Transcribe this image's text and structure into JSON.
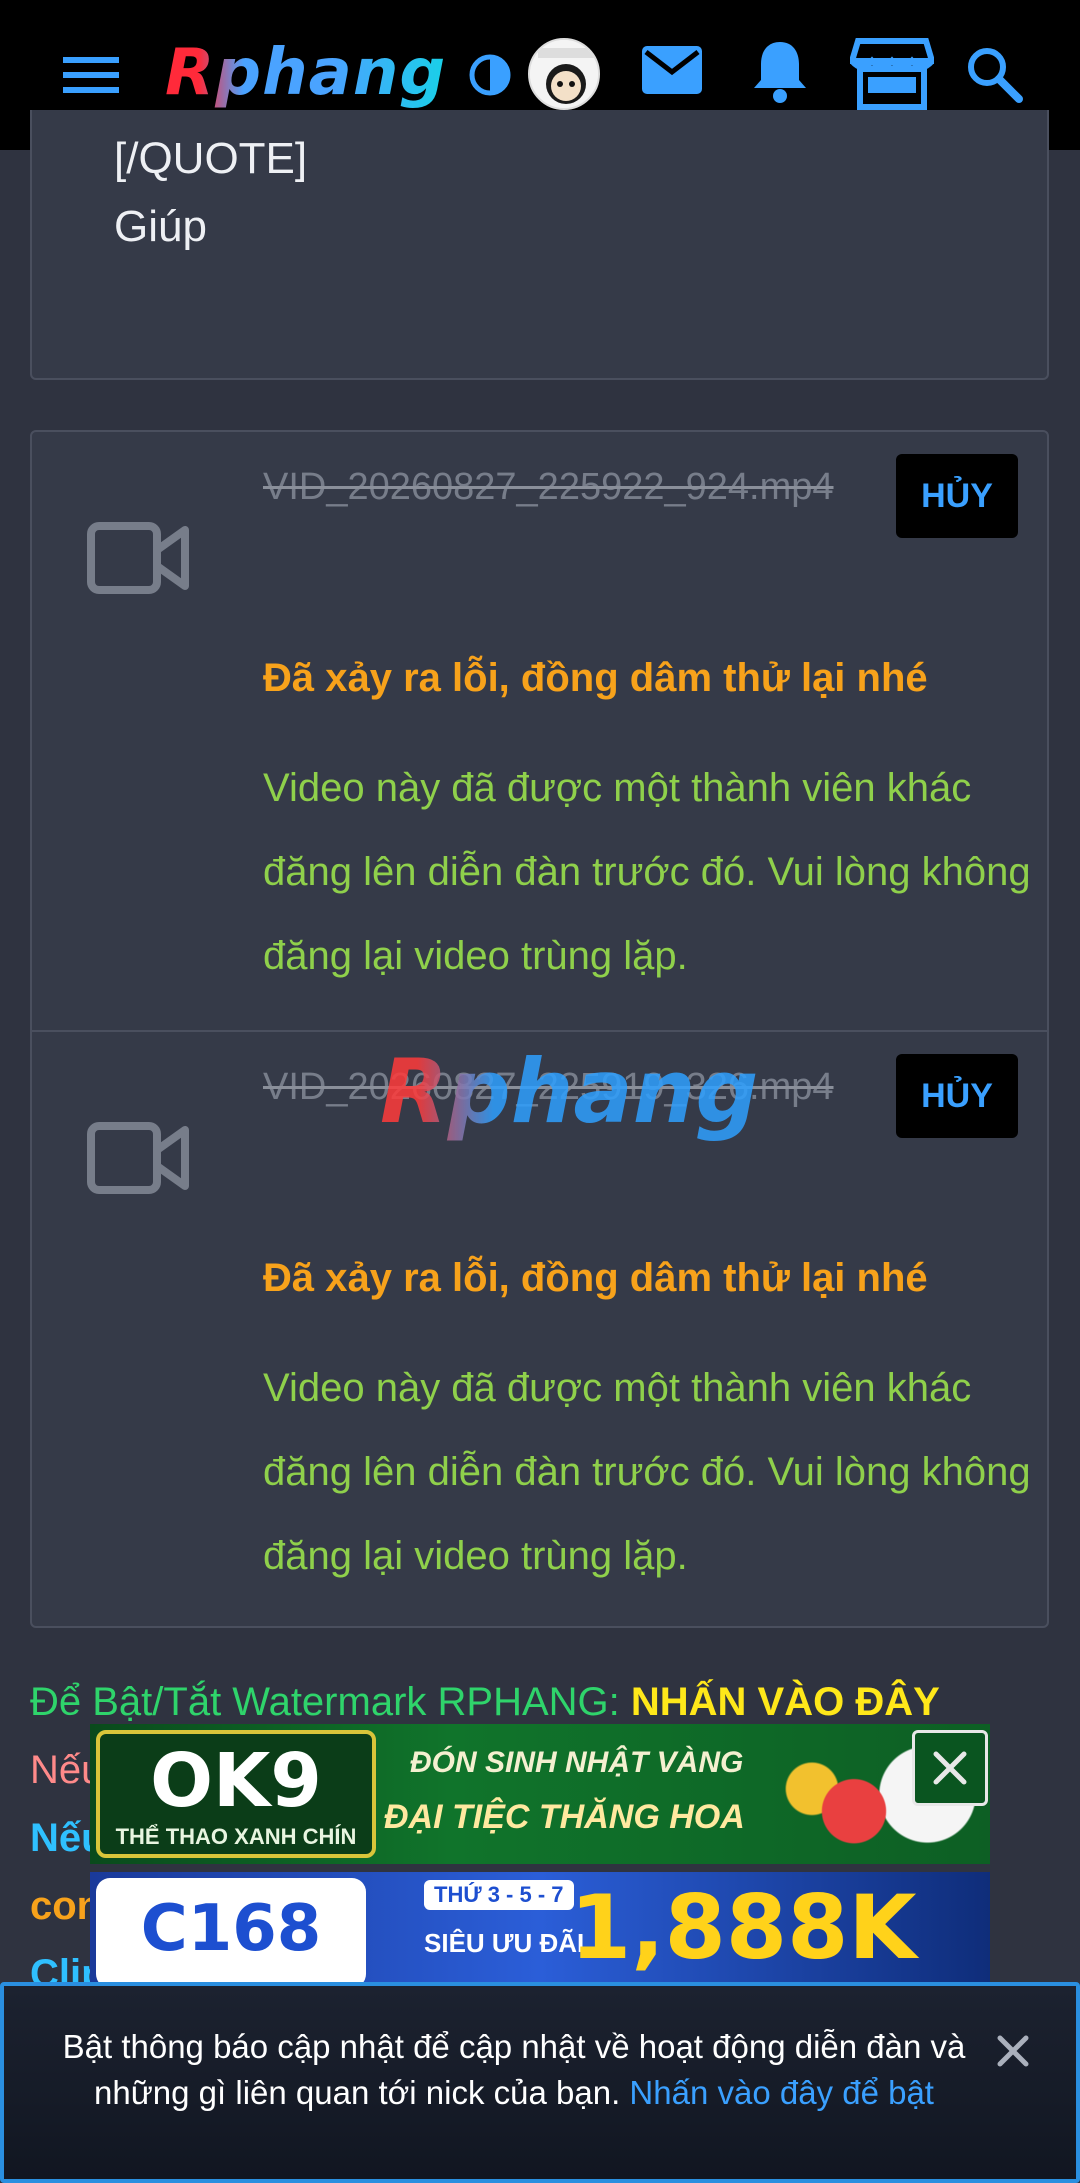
{
  "header": {
    "logo_text": "Rphang",
    "icons": [
      "menu-icon",
      "contrast-icon",
      "avatar",
      "mail-icon",
      "bell-icon",
      "store-icon",
      "search-icon"
    ]
  },
  "quote": {
    "line1": "[/QUOTE]",
    "line2": "Giúp"
  },
  "uploads": [
    {
      "filename": "VID_20260827_225922_924.mp4",
      "cancel_label": "HỦY",
      "error": "Đã xảy ra lỗi, đồng dâm thử lại nhé",
      "detail": "Video này đã được một thành viên khác đăng lên diễn đàn trước đó. Vui lòng không đăng lại video trùng lặp."
    },
    {
      "filename": "VID_20260827_225919_326.mp4",
      "cancel_label": "HỦY",
      "error": "Đã xảy ra lỗi, đồng dâm thử lại nhé",
      "detail": "Video này đã được một thành viên khác đăng lên diễn đàn trước đó. Vui lòng không đăng lại video trùng lặp."
    }
  ],
  "watermark": "Rphang",
  "footer": {
    "watermark_toggle_prefix": "Để Bật/Tắt Watermark RPHANG:",
    "watermark_toggle_link": "NHẤN VÀO ĐÂY",
    "line2_partial": "Nếu",
    "line3_partial": "Nếu",
    "line4_partial": "con",
    "line5_partial": "Clip"
  },
  "ads": {
    "ad1_brand": "OK9",
    "ad1_sub": "THỂ THAO XANH CHÍN",
    "ad1_line1": "ĐÓN SINH NHẬT VÀNG",
    "ad1_line2": "ĐẠI TIỆC THĂNG HOA",
    "ad2_brand": "C168",
    "ad2_days": "THỨ 3 - 5 - 7",
    "ad2_promo": "SIÊU ƯU ĐÃI",
    "ad2_amount": "1,888K"
  },
  "notice": {
    "text": "Bật thông báo cập nhật để cập nhật về hoạt động diễn đàn và những gì liên quan tới nick của bạn.",
    "link": "Nhấn vào đây để bật"
  },
  "colors": {
    "accent_blue": "#3aa0ff",
    "error_orange": "#f7a21b",
    "detail_green": "#8fd04b",
    "panel_bg": "#353a48",
    "page_bg": "#2f3340"
  }
}
